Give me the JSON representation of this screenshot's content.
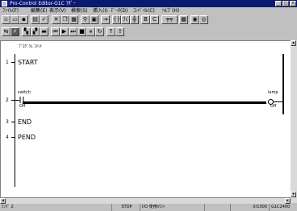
{
  "window": {
    "title": "Pro-Control Editor-G1C ﾗﾀﾞｰ",
    "buttons": {
      "minimize": "_",
      "maximize": "□",
      "close": "×"
    }
  },
  "menu": [
    "ﾌｧｲﾙ(F)",
    "編集(E)",
    "表示(V)",
    "検索(S)",
    "挿入(I)",
    "ﾃﾞｰﾀ(D)",
    "ｺﾝﾊﾟｲﾙ(C)",
    "ﾍﾙﾌﾟ(H)"
  ],
  "toolbar1": [
    "new-icon",
    "open-icon",
    "save-icon",
    "print-icon",
    "check-icon",
    "cut-icon",
    "copy-icon",
    "paste-icon",
    "find-icon",
    "tag-icon",
    "insert-icon",
    "contact-icon",
    "coil-icon",
    "branch-icon",
    "b-icon",
    "c-icon",
    "timer-icon",
    "grid-icon",
    "monitor-icon",
    "settings-icon"
  ],
  "toolbar2": [
    "mode-icon",
    "online-icon",
    "run-icon",
    "stop-icon",
    "step-icon",
    "first-icon",
    "prev-icon",
    "next-icon",
    "last-icon",
    "pause-icon",
    "refresh-icon",
    "arrow-up-icon",
    "export-icon"
  ],
  "document": {
    "header": "ﾌﾟﾛｸﾞﾗﾑ ｺﾒﾝﾄ",
    "rungs": [
      {
        "num": "1",
        "instruction": "START"
      },
      {
        "num": "2",
        "left_label": "switch",
        "left_state": "Off",
        "right_label": "lamp",
        "right_state": "Off"
      },
      {
        "num": "3",
        "instruction": "END"
      },
      {
        "num": "4",
        "instruction": "PEND"
      }
    ]
  },
  "status": {
    "rung": "ﾗﾝｸﾞ 2",
    "mode": "STOP",
    "io": "I/O 使用ｶｳﾝﾄ",
    "count": "0/1000",
    "model": "G1C2400"
  }
}
